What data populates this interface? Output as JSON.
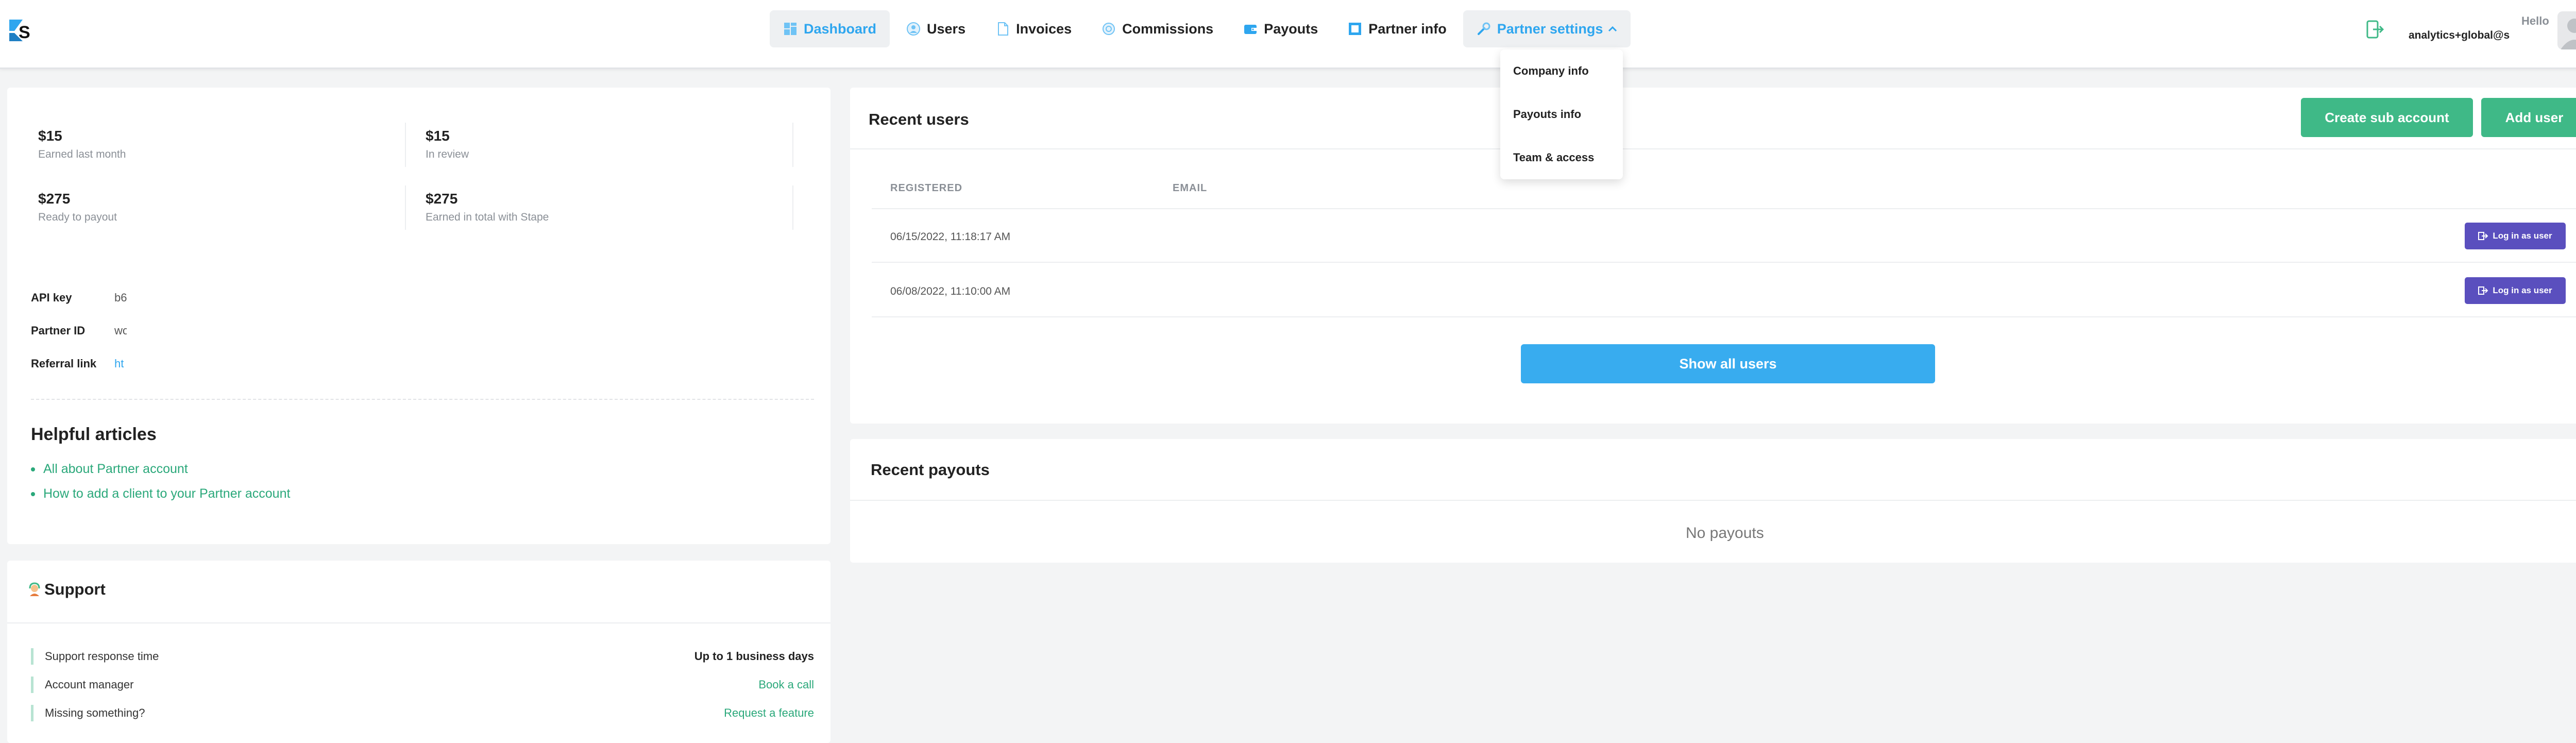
{
  "header": {
    "nav": [
      {
        "label": "Dashboard",
        "icon": "dashboard-icon",
        "active": true
      },
      {
        "label": "Users",
        "icon": "users-icon"
      },
      {
        "label": "Invoices",
        "icon": "invoice-icon"
      },
      {
        "label": "Commissions",
        "icon": "commissions-icon"
      },
      {
        "label": "Payouts",
        "icon": "wallet-icon"
      },
      {
        "label": "Partner info",
        "icon": "partner-info-icon"
      },
      {
        "label": "Partner settings",
        "icon": "wrench-icon",
        "open": true
      }
    ],
    "hello": "Hello",
    "user_email": "analytics+global@s"
  },
  "dropdown": {
    "items": [
      "Company info",
      "Payouts info",
      "Team & access"
    ]
  },
  "stats": [
    {
      "value": "$15",
      "label": "Earned last month"
    },
    {
      "value": "$15",
      "label": "In review"
    },
    {
      "value": "$275",
      "label": "Ready to payout"
    },
    {
      "value": "$275",
      "label": "Earned in total with Stape"
    }
  ],
  "credentials": [
    {
      "key": "API key",
      "value": "b6"
    },
    {
      "key": "Partner ID",
      "value": "wo"
    },
    {
      "key": "Referral link",
      "value": "ht"
    }
  ],
  "articles": {
    "title": "Helpful articles",
    "items": [
      "All about Partner account",
      "How to add a client to your Partner account"
    ]
  },
  "support": {
    "title": "Support",
    "rows": [
      {
        "label": "Support response time",
        "value": "Up to 1 business days"
      },
      {
        "label": "Account manager",
        "link": "Book a call"
      },
      {
        "label": "Missing something?",
        "link": "Request a feature"
      }
    ]
  },
  "recent_users": {
    "title": "Recent users",
    "create_label": "Create sub account",
    "add_label": "Add user",
    "columns": [
      "REGISTERED",
      "EMAIL"
    ],
    "rows": [
      {
        "registered": "06/15/2022, 11:18:17 AM",
        "action": "Log in as user"
      },
      {
        "registered": "06/08/2022, 11:10:00 AM",
        "action": "Log in as user"
      }
    ],
    "show_all_label": "Show all users"
  },
  "recent_payouts": {
    "title": "Recent payouts",
    "empty": "No payouts"
  },
  "colors": {
    "accent_blue": "#2ea6ef",
    "green": "#3fb987",
    "purple": "#5a4fbe"
  }
}
